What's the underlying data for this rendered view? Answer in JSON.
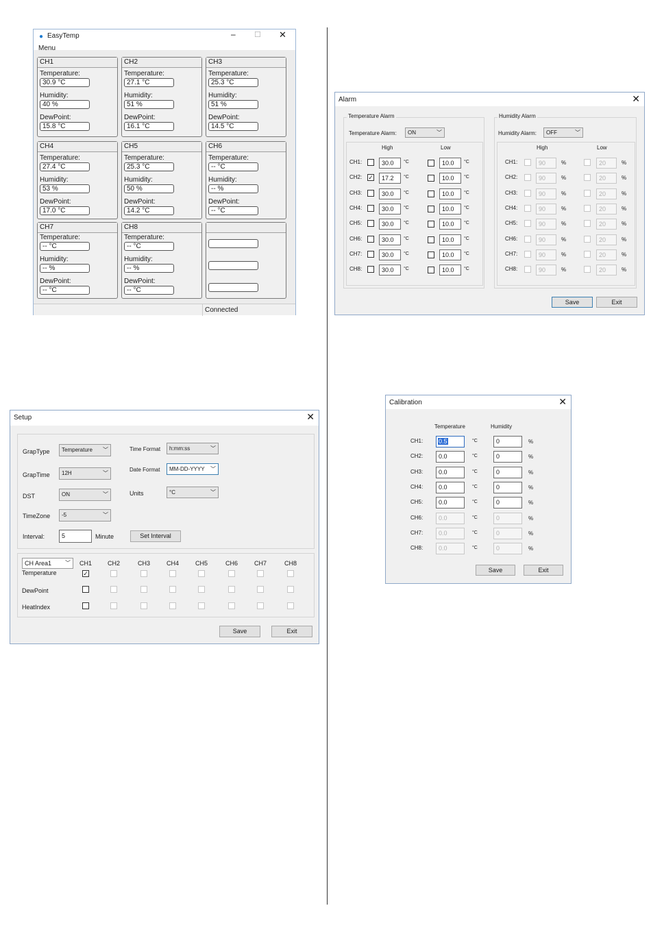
{
  "easytemp": {
    "title": "EasyTemp",
    "menu": "Menu",
    "status": "Connected",
    "labels": {
      "temperature": "Temperature:",
      "humidity": "Humidity:",
      "dewpoint": "DewPoint:"
    },
    "channels": [
      {
        "name": "CH1",
        "temp": "30.9  °C",
        "hum": "40  %",
        "dew": "15.8  °C"
      },
      {
        "name": "CH2",
        "temp": "27.1  °C",
        "hum": "51  %",
        "dew": "16.1  °C"
      },
      {
        "name": "CH3",
        "temp": "25.3  °C",
        "hum": "51  %",
        "dew": "14.5  °C"
      },
      {
        "name": "CH4",
        "temp": "27.4  °C",
        "hum": "53  %",
        "dew": "17.0  °C"
      },
      {
        "name": "CH5",
        "temp": "25.3  °C",
        "hum": "50  %",
        "dew": "14.2  °C"
      },
      {
        "name": "CH6",
        "temp": "-- °C",
        "hum": "--  %",
        "dew": "-- °C"
      },
      {
        "name": "CH7",
        "temp": "-- °C",
        "hum": "--  %",
        "dew": "-- °C"
      },
      {
        "name": "CH8",
        "temp": "-- °C",
        "hum": "--  %",
        "dew": "-- °C"
      }
    ]
  },
  "alarm": {
    "title": "Alarm",
    "temp_group": "Temperature Alarm",
    "temp_alarm_label": "Temperature Alarm:",
    "temp_alarm_value": "ON",
    "hum_group": "Humidity Alarm",
    "hum_alarm_label": "Humidity Alarm:",
    "hum_alarm_value": "OFF",
    "high": "High",
    "low": "Low",
    "unit_c": "°C",
    "unit_pct": "%",
    "rows": [
      {
        "ch": "CH1:",
        "t_high_checked": "",
        "t_high": "30.0",
        "t_low": "10.0",
        "h_high": "90",
        "h_low": "20"
      },
      {
        "ch": "CH2:",
        "t_high_checked": "✓",
        "t_high": "17.2",
        "t_low": "10.0",
        "h_high": "90",
        "h_low": "20"
      },
      {
        "ch": "CH3:",
        "t_high_checked": "",
        "t_high": "30.0",
        "t_low": "10.0",
        "h_high": "90",
        "h_low": "20"
      },
      {
        "ch": "CH4:",
        "t_high_checked": "",
        "t_high": "30.0",
        "t_low": "10.0",
        "h_high": "90",
        "h_low": "20"
      },
      {
        "ch": "CH5:",
        "t_high_checked": "",
        "t_high": "30.0",
        "t_low": "10.0",
        "h_high": "90",
        "h_low": "20"
      },
      {
        "ch": "CH6:",
        "t_high_checked": "",
        "t_high": "30.0",
        "t_low": "10.0",
        "h_high": "90",
        "h_low": "20"
      },
      {
        "ch": "CH7:",
        "t_high_checked": "",
        "t_high": "30.0",
        "t_low": "10.0",
        "h_high": "90",
        "h_low": "20"
      },
      {
        "ch": "CH8:",
        "t_high_checked": "",
        "t_high": "30.0",
        "t_low": "10.0",
        "h_high": "90",
        "h_low": "20"
      }
    ],
    "save": "Save",
    "exit": "Exit"
  },
  "setup": {
    "title": "Setup",
    "grap_type_label": "GrapType",
    "grap_type_value": "Temperature",
    "time_format_label": "Time Format",
    "time_format_value": "h:mm:ss",
    "grap_time_label": "GrapTime",
    "grap_time_value": "12H",
    "date_format_label": "Date Format",
    "date_format_value": "MM-DD-YYYY",
    "dst_label": "DST",
    "dst_value": "ON",
    "units_label": "Units",
    "units_value": "°C",
    "timezone_label": "TimeZone",
    "timezone_value": "-5",
    "interval_label": "Interval:",
    "interval_value": "5",
    "minute_label": "Minute",
    "set_interval": "Set Interval",
    "area_value": "CH Area1",
    "columns": [
      "CH1",
      "CH2",
      "CH3",
      "CH4",
      "CH5",
      "CH6",
      "CH7",
      "CH8"
    ],
    "row_labels": [
      "Temperature",
      "DewPoint",
      "HeatIndex"
    ],
    "checked_mark": "✓",
    "save": "Save",
    "exit": "Exit"
  },
  "calibration": {
    "title": "Calibration",
    "temperature": "Temperature",
    "humidity": "Humidity",
    "unit_c": "°C",
    "unit_pct": "%",
    "rows": [
      {
        "ch": "CH1:",
        "t": "0.5",
        "h": "0"
      },
      {
        "ch": "CH2:",
        "t": "0.0",
        "h": "0"
      },
      {
        "ch": "CH3:",
        "t": "0.0",
        "h": "0"
      },
      {
        "ch": "CH4:",
        "t": "0.0",
        "h": "0"
      },
      {
        "ch": "CH5:",
        "t": "0.0",
        "h": "0"
      },
      {
        "ch": "CH6:",
        "t": "0.0",
        "h": "0"
      },
      {
        "ch": "CH7:",
        "t": "0.0",
        "h": "0"
      },
      {
        "ch": "CH8:",
        "t": "0.0",
        "h": "0"
      }
    ],
    "save": "Save",
    "exit": "Exit"
  }
}
